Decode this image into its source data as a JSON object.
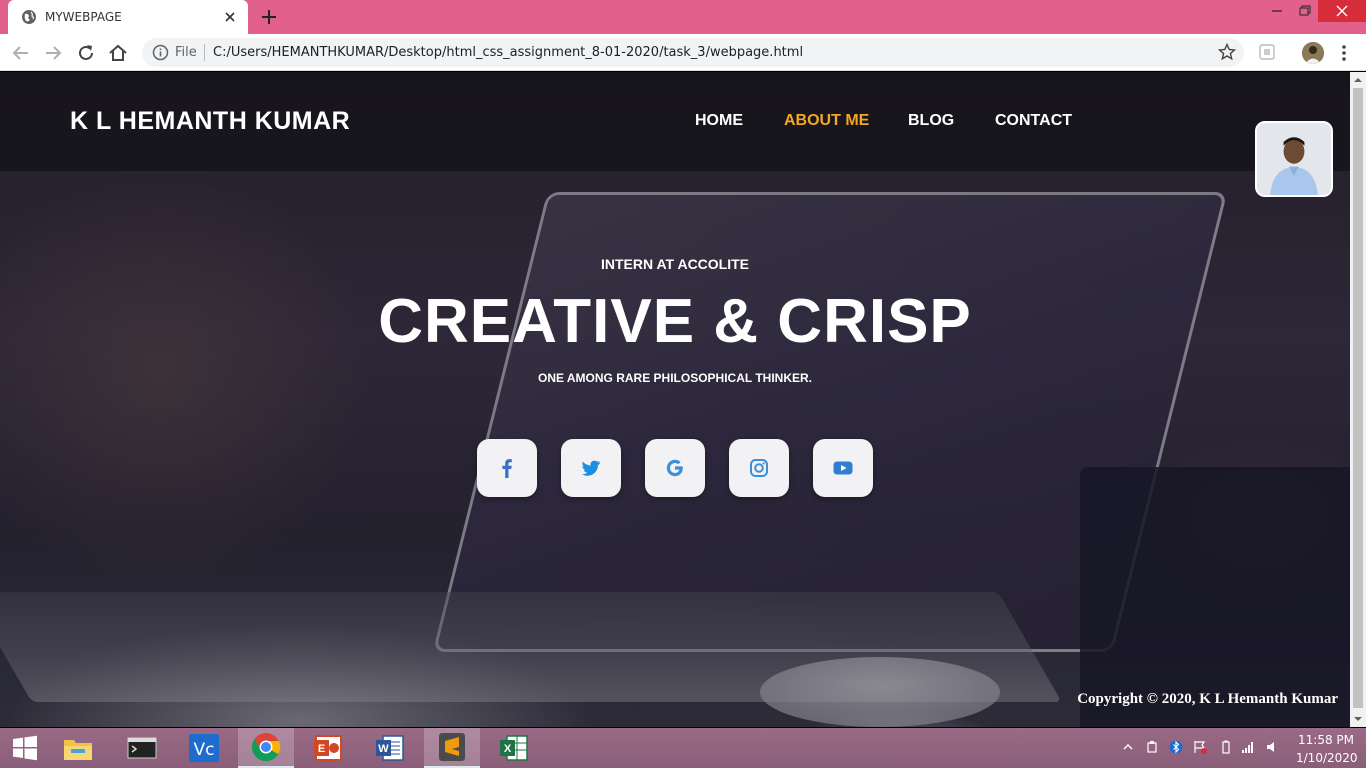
{
  "browser": {
    "tab_title": "MYWEBPAGE",
    "omnibox_scheme": "File",
    "url": "C:/Users/HEMANTHKUMAR/Desktop/html_css_assignment_8-01-2020/task_3/webpage.html"
  },
  "site": {
    "brand": "K L HEMANTH KUMAR",
    "nav": [
      {
        "label": "HOME",
        "active": false
      },
      {
        "label": "ABOUT ME",
        "active": true
      },
      {
        "label": "BLOG",
        "active": false
      },
      {
        "label": "CONTACT",
        "active": false
      }
    ],
    "accent_color": "#f5a623",
    "hero": {
      "subtitle": "INTERN AT ACCOLITE",
      "title": "CREATIVE & CRISP",
      "tagline": "ONE AMONG RARE PHILOSOPHICAL THINKER."
    },
    "social": [
      {
        "name": "facebook-icon",
        "color": "#3b6fc8"
      },
      {
        "name": "twitter-icon",
        "color": "#1da1f2"
      },
      {
        "name": "google-icon",
        "color": "#3d8fd8"
      },
      {
        "name": "instagram-icon",
        "color": "#3d8fd8"
      },
      {
        "name": "youtube-icon",
        "color": "#2f7fd0"
      }
    ],
    "copyright": "Copyright © 2020, K L Hemanth Kumar"
  },
  "taskbar": {
    "apps": [
      "file-explorer-icon",
      "terminal-icon",
      "vscode-icon",
      "chrome-icon",
      "presentation-icon",
      "word-icon",
      "sublime-icon",
      "excel-icon"
    ],
    "active_app": "chrome-icon",
    "time": "11:58 PM",
    "date": "1/10/2020"
  }
}
